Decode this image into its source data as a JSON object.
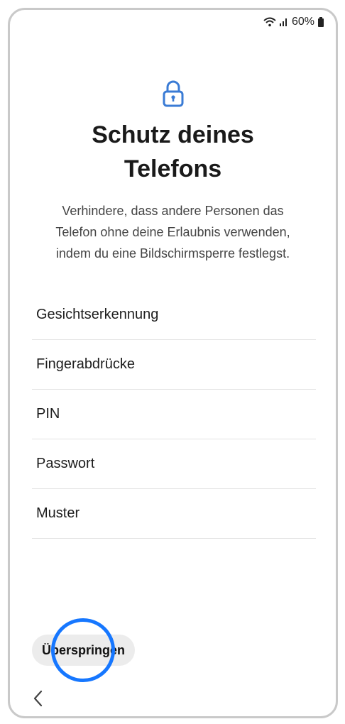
{
  "status_bar": {
    "battery": "60%",
    "icons": [
      "wifi-icon",
      "signal-icon",
      "battery-icon"
    ]
  },
  "header": {
    "icon": "lock-icon",
    "title_line1": "Schutz deines",
    "title_line2": "Telefons"
  },
  "description": {
    "line1": "Verhindere, dass andere Personen das",
    "line2": "Telefon ohne deine Erlaubnis verwenden,",
    "line3": "indem du eine Bildschirmsperre festlegst."
  },
  "options": [
    {
      "label": "Gesichtserkennung"
    },
    {
      "label": "Fingerabdrücke"
    },
    {
      "label": "PIN"
    },
    {
      "label": "Passwort"
    },
    {
      "label": "Muster"
    }
  ],
  "footer": {
    "skip_label": "Überspringen",
    "back_icon": "chevron-left-icon"
  },
  "colors": {
    "accent": "#3a7bd5",
    "touch_indicator": "#1677ff"
  }
}
